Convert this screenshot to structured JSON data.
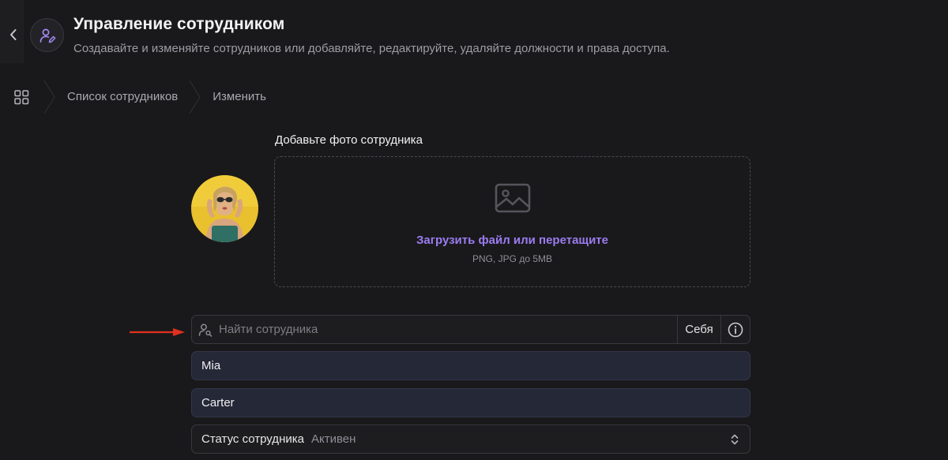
{
  "header": {
    "title": "Управление сотрудником",
    "subtitle": "Создавайте и изменяйте сотрудников или добавляйте, редактируйте, удаляйте должности и права доступа."
  },
  "breadcrumb": {
    "items": [
      {
        "label": "Список сотрудников"
      },
      {
        "label": "Изменить"
      }
    ]
  },
  "photo": {
    "label": "Добавьте фото сотрудника",
    "upload_link": "Загрузить файл или перетащите",
    "upload_hint": "PNG, JPG до 5MB"
  },
  "search": {
    "placeholder": "Найти сотрудника",
    "self_button": "Себя"
  },
  "form": {
    "first_name": "Mia",
    "last_name": "Carter",
    "status_label": "Статус сотрудника",
    "status_value": "Активен"
  },
  "colors": {
    "background": "#19191b",
    "accent": "#9b7cf0",
    "field_filled": "#252836",
    "annotation_arrow": "#e0301e"
  }
}
